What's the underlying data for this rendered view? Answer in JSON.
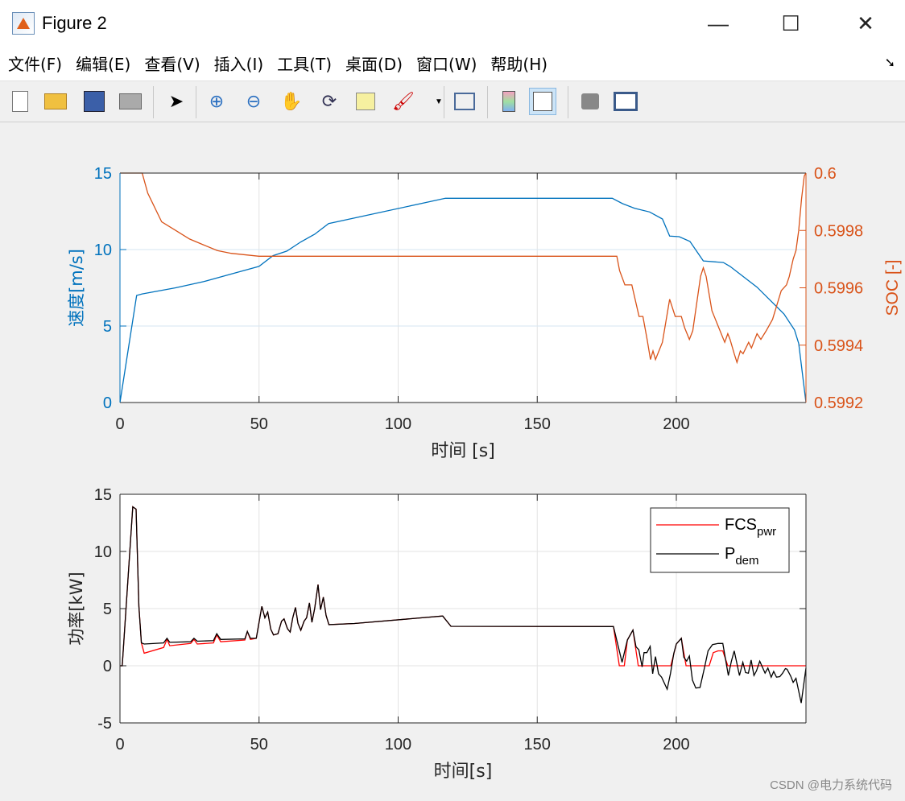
{
  "window": {
    "title": "Figure 2",
    "minimize": "—",
    "maximize": "☐",
    "close": "✕"
  },
  "menu": [
    "文件(F)",
    "编辑(E)",
    "查看(V)",
    "插入(I)",
    "工具(T)",
    "桌面(D)",
    "窗口(W)",
    "帮助(H)"
  ],
  "toolbar": [
    "new-file",
    "open-folder",
    "save",
    "print",
    "pointer",
    "zoom-in",
    "zoom-out",
    "pan",
    "rotate-3d",
    "data-cursor",
    "brush",
    "link-plot",
    "colorbar",
    "legend",
    "hide-plot-tools",
    "show-plot-tools"
  ],
  "watermark": "CSDN @电力系统代码",
  "colors": {
    "speed": "#0072BD",
    "soc": "#D95319",
    "fcs": "#FF0000",
    "pdem": "#000000"
  },
  "chart_data": [
    {
      "type": "line",
      "title": "",
      "xlabel": "时间 [s]",
      "ylabel": "速度[m/s]",
      "ylabel_right": "SOC [-]",
      "xlim": [
        0,
        246.6
      ],
      "ylim": [
        0,
        15
      ],
      "ylim_right": [
        0.5992,
        0.6
      ],
      "xticks": [
        0,
        50,
        100,
        150,
        200
      ],
      "yticks": [
        0,
        5,
        10,
        15
      ],
      "yticks_right": [
        "0.5992",
        "0.5994",
        "0.5996",
        "0.5998",
        "0.6"
      ],
      "grid": true,
      "series": [
        {
          "name": "速度",
          "axis": "left",
          "x": [
            0,
            6,
            8,
            20,
            30,
            40,
            50,
            55,
            60,
            65,
            70,
            75,
            117,
            177,
            180.7,
            185,
            190.4,
            195,
            197.6,
            201,
            204.9,
            209.7,
            216.9,
            219.3,
            229,
            238.7,
            242.5,
            244,
            246.6
          ],
          "y": [
            0,
            7,
            7.1,
            7.5,
            7.9,
            8.4,
            8.9,
            9.6,
            9.9,
            10.5,
            11.0,
            11.7,
            13.35,
            13.35,
            13.0,
            12.7,
            12.46,
            12.0,
            10.88,
            10.84,
            10.53,
            9.26,
            9.15,
            8.9,
            7.54,
            5.79,
            4.74,
            3.86,
            0
          ]
        },
        {
          "name": "SOC",
          "axis": "right",
          "x": [
            0,
            8,
            10,
            15,
            20,
            25,
            30,
            35,
            40,
            50,
            177,
            178.6,
            179.6,
            181.5,
            184,
            186.6,
            188,
            189.5,
            190.7,
            191.6,
            192.5,
            195,
            197.6,
            199.6,
            201.8,
            203,
            204.7,
            205.9,
            208.7,
            209.7,
            210.7,
            212.8,
            217.4,
            218.5,
            219.3,
            220.8,
            221.8,
            223,
            224,
            226,
            227,
            229,
            230.4,
            232.3,
            234.6,
            237.7,
            239.6,
            240.6,
            242,
            243,
            244,
            245,
            246,
            246.6
          ],
          "y": [
            0.6,
            0.6,
            0.59993,
            0.59983,
            0.5998,
            0.59977,
            0.59975,
            0.59973,
            0.59972,
            0.59971,
            0.59971,
            0.59971,
            0.59966,
            0.59961,
            0.59961,
            0.5995,
            0.5995,
            0.59942,
            0.59935,
            0.59938,
            0.59935,
            0.59941,
            0.59956,
            0.5995,
            0.5995,
            0.59946,
            0.59942,
            0.59945,
            0.59964,
            0.59967,
            0.59964,
            0.59952,
            0.59941,
            0.59944,
            0.59942,
            0.59937,
            0.59934,
            0.59938,
            0.59937,
            0.59941,
            0.59939,
            0.59944,
            0.59942,
            0.59945,
            0.59949,
            0.59959,
            0.59961,
            0.59964,
            0.5997,
            0.59973,
            0.5998,
            0.59991,
            0.59999,
            0.6
          ]
        }
      ]
    },
    {
      "type": "line",
      "title": "",
      "xlabel": "时间[s]",
      "ylabel": "功率[kW]",
      "xlim": [
        0,
        246.6
      ],
      "ylim": [
        -5,
        15
      ],
      "xticks": [
        0,
        50,
        100,
        150,
        200
      ],
      "yticks": [
        -5,
        0,
        5,
        10,
        15
      ],
      "grid": true,
      "legend_position": "top-right",
      "legend": [
        {
          "label": "FCS",
          "sub": "pwr"
        },
        {
          "label": "P",
          "sub": "dem"
        }
      ],
      "series": [
        {
          "name": "FCS_pwr",
          "x": [
            0,
            0.8,
            4.6,
            5.8,
            6.8,
            7.7,
            8.7,
            15.7,
            16.9,
            17.9,
            25.4,
            26.6,
            27.8,
            33.6,
            34.8,
            36.2,
            44.9,
            45.8,
            46.9,
            49,
            51,
            52.1,
            53.1,
            54.2,
            55.2,
            56.8,
            58.1,
            59,
            60.2,
            61.2,
            62.1,
            63.1,
            64,
            65,
            66.2,
            67.1,
            68.1,
            69,
            70,
            71.2,
            72.1,
            73.1,
            74.1,
            75.1,
            84.3,
            116,
            119,
            177.4,
            179.5,
            181.3,
            182.4,
            184.4,
            186.3,
            198,
            200,
            201.8,
            203.5,
            211.8,
            213.3,
            215,
            216.7,
            218.5,
            246.6
          ],
          "y": [
            0,
            0,
            13.9,
            13.7,
            5.2,
            2.0,
            1.1,
            1.6,
            2.3,
            1.75,
            1.95,
            2.3,
            1.9,
            2.0,
            2.7,
            2.1,
            2.25,
            3.0,
            2.3,
            2.4,
            5.2,
            4.2,
            4.7,
            3.2,
            2.7,
            2.8,
            3.9,
            4.1,
            3.25,
            2.95,
            4.2,
            5.1,
            3.7,
            3.1,
            3.9,
            4.2,
            5.5,
            3.8,
            5.0,
            7.1,
            4.9,
            6.0,
            4.4,
            3.6,
            3.7,
            4.35,
            3.45,
            3.43,
            0,
            0,
            2.25,
            3.12,
            0,
            0,
            1.9,
            2.4,
            0,
            0,
            1.15,
            1.3,
            1.3,
            0,
            0
          ]
        },
        {
          "name": "P_dem",
          "x": [
            0,
            0.8,
            4.6,
            5.8,
            6.8,
            7.7,
            8.7,
            15.7,
            16.9,
            17.9,
            25.4,
            26.6,
            27.8,
            33.6,
            34.8,
            36.2,
            44.9,
            45.8,
            46.9,
            49,
            51,
            52.1,
            53.1,
            54.2,
            55.2,
            56.8,
            58.1,
            59,
            60.2,
            61.2,
            62.1,
            63.1,
            64,
            65,
            66.2,
            67.1,
            68.1,
            69,
            70,
            71.2,
            72.1,
            73.1,
            74.1,
            75.1,
            84.3,
            116,
            119,
            177.4,
            180.5,
            182.4,
            184.4,
            185.5,
            186.5,
            187.7,
            188.4,
            189.4,
            190.6,
            191.5,
            192.5,
            193.6,
            194.7,
            196.7,
            197.9,
            199.1,
            200,
            201.8,
            202.7,
            203.7,
            204.7,
            205.8,
            207,
            208.5,
            210.2,
            211.4,
            213,
            215,
            216.7,
            218.7,
            219.8,
            220.8,
            222.7,
            223.9,
            224.9,
            225.9,
            226.9,
            227.9,
            228.8,
            230,
            231.9,
            232.9,
            234.1,
            235,
            236,
            237.2,
            238.2,
            239.2,
            239.8,
            241.1,
            242,
            243,
            244.9,
            246.6
          ],
          "y": [
            0,
            0,
            13.9,
            13.7,
            5.2,
            2.0,
            1.9,
            2.0,
            2.4,
            2.05,
            2.1,
            2.4,
            2.15,
            2.2,
            2.8,
            2.3,
            2.35,
            3.0,
            2.4,
            2.4,
            5.2,
            4.2,
            4.7,
            3.2,
            2.7,
            2.8,
            3.9,
            4.1,
            3.25,
            2.95,
            4.2,
            5.1,
            3.7,
            3.1,
            3.9,
            4.2,
            5.5,
            3.8,
            5.0,
            7.1,
            4.9,
            6.0,
            4.4,
            3.6,
            3.7,
            4.35,
            3.45,
            3.43,
            0.3,
            2.25,
            3.12,
            1.66,
            1.4,
            -0.1,
            1.15,
            1.15,
            1.7,
            -0.7,
            0.8,
            -0.7,
            -1.0,
            -2.05,
            -0.68,
            1.1,
            1.9,
            2.4,
            0.75,
            0.4,
            0.85,
            -1.25,
            -1.95,
            -1.9,
            -0.1,
            1.3,
            1.85,
            1.95,
            1.95,
            -0.85,
            0.4,
            1.3,
            -0.85,
            0.3,
            -0.6,
            -0.65,
            0.5,
            -0.85,
            -0.45,
            0.4,
            -0.65,
            -0.2,
            -1.0,
            -0.5,
            -1.0,
            -0.95,
            -0.65,
            -0.25,
            -0.3,
            -0.9,
            -1.45,
            -1.1,
            -3.26,
            -0.2
          ]
        }
      ]
    }
  ]
}
